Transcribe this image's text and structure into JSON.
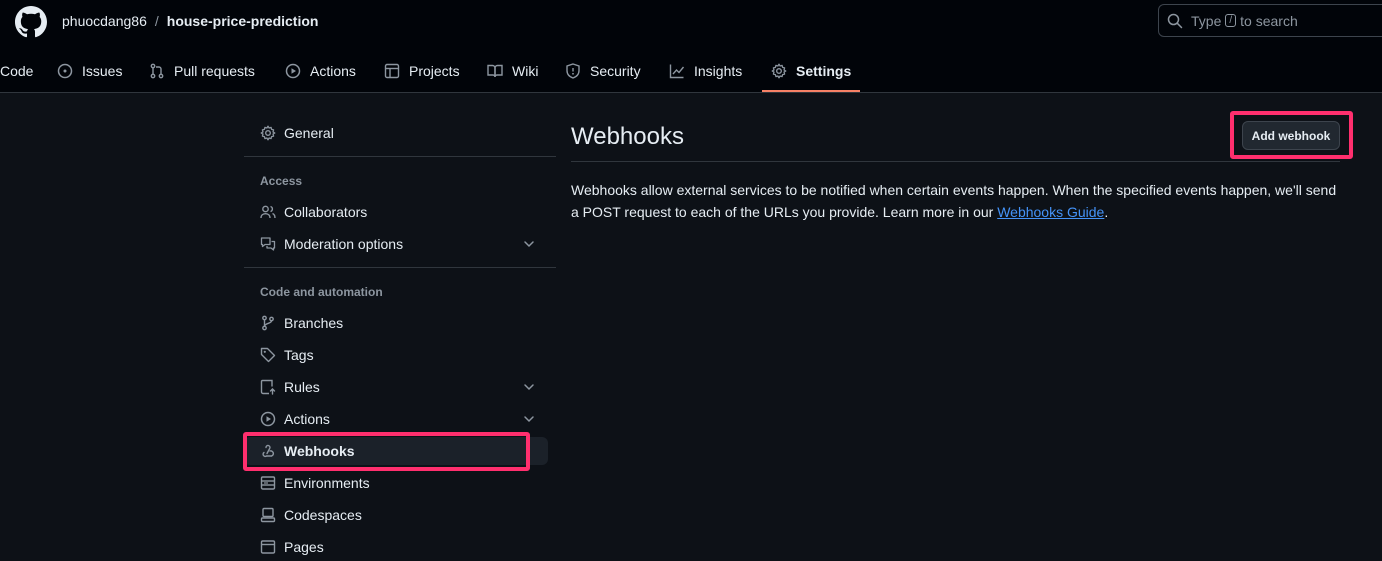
{
  "header": {
    "owner": "phuocdang86",
    "separator": "/",
    "repo": "house-price-prediction",
    "search": {
      "prefix": "Type",
      "kbd": "/",
      "suffix": "to search"
    }
  },
  "repo_nav": {
    "tabs": [
      {
        "label": "Code",
        "icon": "code-icon"
      },
      {
        "label": "Issues",
        "icon": "issue-icon"
      },
      {
        "label": "Pull requests",
        "icon": "pull-request-icon"
      },
      {
        "label": "Actions",
        "icon": "play-icon"
      },
      {
        "label": "Projects",
        "icon": "table-icon"
      },
      {
        "label": "Wiki",
        "icon": "book-icon"
      },
      {
        "label": "Security",
        "icon": "shield-icon"
      },
      {
        "label": "Insights",
        "icon": "graph-icon"
      },
      {
        "label": "Settings",
        "icon": "gear-icon",
        "selected": true
      }
    ]
  },
  "sidebar": {
    "general": "General",
    "access_heading": "Access",
    "collaborators": "Collaborators",
    "moderation": "Moderation options",
    "code_heading": "Code and automation",
    "branches": "Branches",
    "tags": "Tags",
    "rules": "Rules",
    "actions": "Actions",
    "webhooks": "Webhooks",
    "environments": "Environments",
    "codespaces": "Codespaces",
    "pages": "Pages"
  },
  "main": {
    "title": "Webhooks",
    "add_button": "Add webhook",
    "description_1": "Webhooks allow external services to be notified when certain events happen. When the specified events happen, we'll send a POST request to each of the URLs you provide. Learn more in our",
    "link": "Webhooks Guide",
    "description_end": "."
  },
  "colors": {
    "background": "#0d1117",
    "header_background": "#010409",
    "highlight": "#ff2f6e",
    "selected_underline": "#f78166",
    "link": "#4493f8"
  }
}
